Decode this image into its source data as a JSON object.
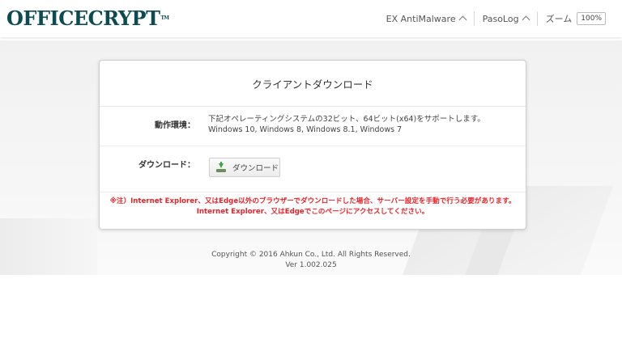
{
  "header": {
    "logo_text": "OFFICECRYPT",
    "logo_tm": "TM",
    "nav": [
      {
        "label": "EX AntiMalware"
      },
      {
        "label": "PasoLog"
      }
    ],
    "zoom_label": "ズーム",
    "zoom_value": "100%"
  },
  "card": {
    "title": "クライアントダウンロード",
    "env_label": "動作環境：",
    "env_line1": "下記オペレーティングシステムの32ビット、64ビット(x64)をサポートします。",
    "env_line2": "Windows 10, Windows 8, Windows 8.1, Windows 7",
    "download_label": "ダウンロード：",
    "download_button": "ダウンロード",
    "notice_line1": "※注）Internet Explorer、又はEdge以外のブラウザーでダウンロードした場合、サーバー設定を手動で行う必要があります。",
    "notice_line2": "Internet Explorer、又はEdgeでこのページにアクセスしてください。"
  },
  "footer": {
    "copyright": "Copyright © 2016 Ahkun Co., Ltd. All Rights Reserved.",
    "version": "Ver 1.002.025"
  },
  "colors": {
    "logo": "#0d4b52",
    "notice": "#e8232a"
  },
  "icons": {
    "nav_chevron": "chevron-up-icon",
    "download": "download-icon"
  }
}
